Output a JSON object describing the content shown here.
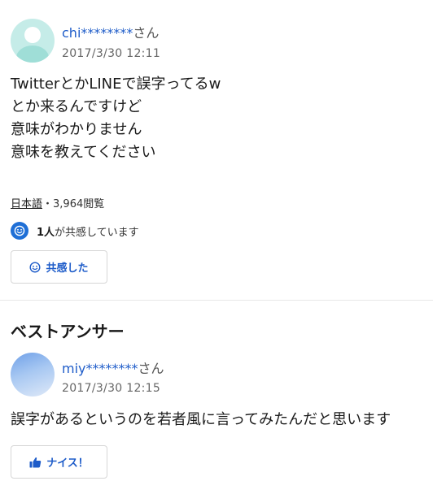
{
  "question": {
    "user": "chi********",
    "suffix": "さん",
    "date": "2017/3/30 12:11",
    "lines": [
      "TwitterとかLINEで誤字ってるw",
      "とか来るんですけど",
      "意味がわかりません",
      "意味を教えてください"
    ],
    "category": "日本語",
    "views": "・3,964閲覧",
    "empathy_count": "1人",
    "empathy_text": "が共感しています",
    "empathy_button": "共感した"
  },
  "best_answer": {
    "heading": "ベストアンサー",
    "user": "miy********",
    "suffix": "さん",
    "date": "2017/3/30 12:15",
    "text": "誤字があるというのを若者風に言ってみたんだと思います",
    "nice_button": "ナイス！"
  },
  "colors": {
    "link": "#1e5cc9",
    "accent": "#1f6fd6",
    "border": "#d6d6d6"
  }
}
